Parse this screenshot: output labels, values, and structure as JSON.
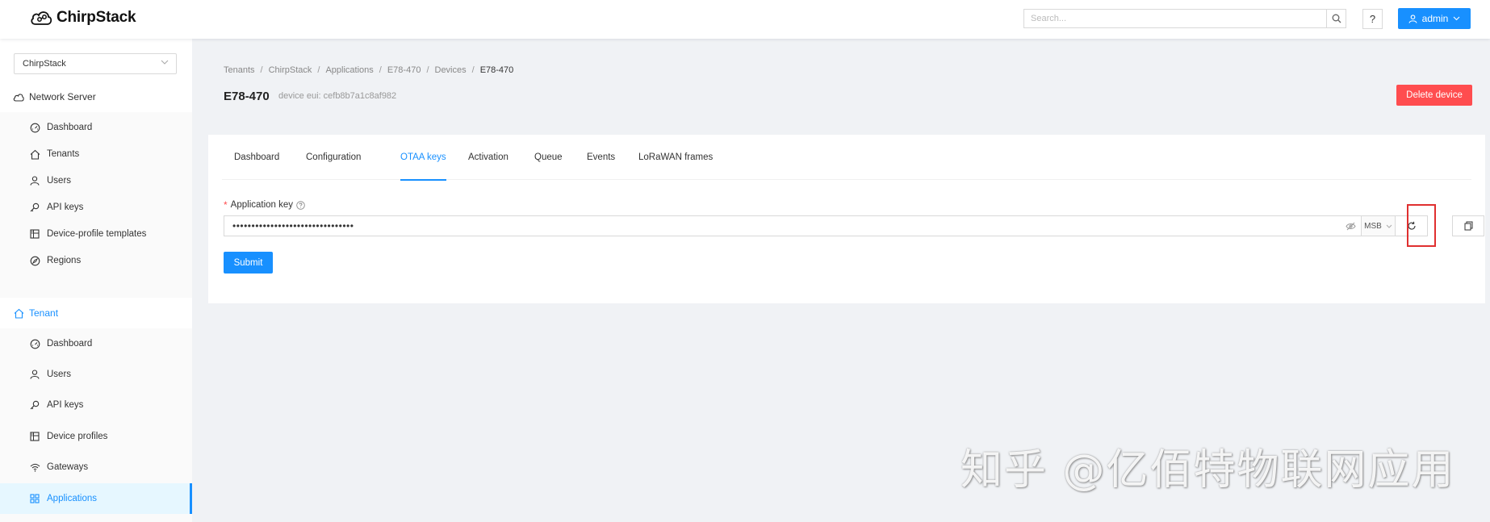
{
  "header": {
    "brand": "ChirpStack",
    "search_placeholder": "Search...",
    "help_label": "?",
    "user_label": "admin"
  },
  "sidebar": {
    "tenant_select": "ChirpStack",
    "network_server": {
      "label": "Network Server",
      "items": [
        "Dashboard",
        "Tenants",
        "Users",
        "API keys",
        "Device-profile templates",
        "Regions"
      ]
    },
    "tenant": {
      "label": "Tenant",
      "items": [
        "Dashboard",
        "Users",
        "API keys",
        "Device profiles",
        "Gateways",
        "Applications"
      ],
      "selected": "Applications"
    }
  },
  "breadcrumb": [
    "Tenants",
    "ChirpStack",
    "Applications",
    "E78-470",
    "Devices",
    "E78-470"
  ],
  "page": {
    "title": "E78-470",
    "subtitle": "device eui: cefb8b7a1c8af982",
    "delete_label": "Delete device"
  },
  "tabs": [
    "Dashboard",
    "Configuration",
    "OTAA keys",
    "Activation",
    "Queue",
    "Events",
    "LoRaWAN frames"
  ],
  "active_tab": "OTAA keys",
  "form": {
    "required_mark": "*",
    "label": "Application key",
    "masked_value": "••••••••••••••••••••••••••••••••",
    "byte_order": "MSB",
    "submit_label": "Submit"
  },
  "watermark": "知乎 @亿佰特物联网应用",
  "colors": {
    "primary": "#1890ff",
    "danger": "#ff4d4f",
    "highlight": "#e03030"
  }
}
